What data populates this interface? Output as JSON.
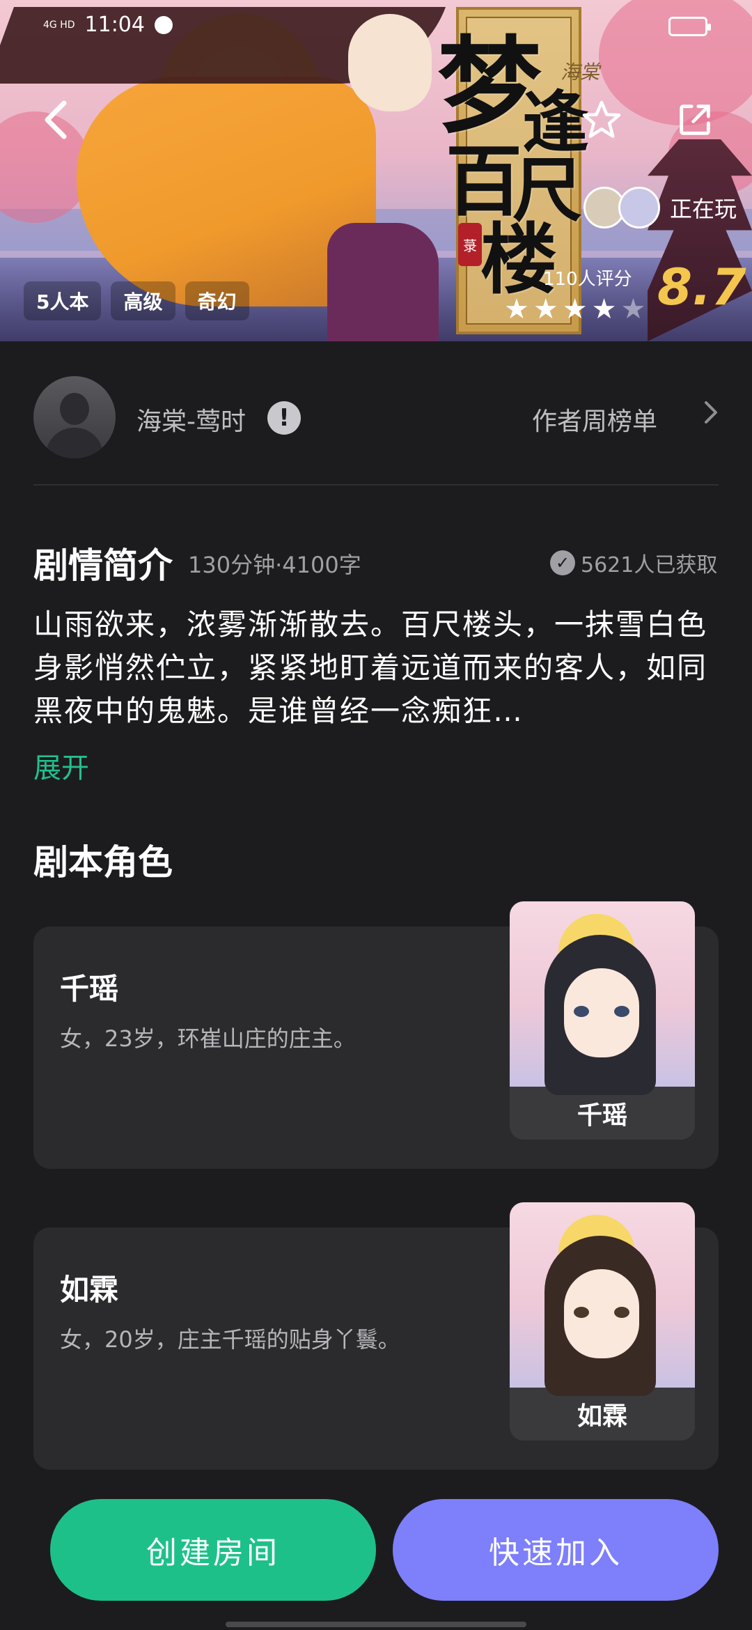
{
  "status_bar": {
    "network": "4G HD",
    "time": "11:04"
  },
  "hero": {
    "title_chars": [
      "梦",
      "逢",
      "百",
      "尺",
      "楼"
    ],
    "subtitle": "海棠",
    "seal": "菉",
    "players_text": "正在玩",
    "reviews_text": "110人评分",
    "rating_stars": 4,
    "rating_total": 5,
    "score": "8.7",
    "tags": [
      "5人本",
      "高级",
      "奇幻"
    ]
  },
  "author": {
    "name": "海棠-莺时",
    "warn_icon_text": "!",
    "rank_label": "作者周榜单"
  },
  "synopsis": {
    "title": "剧情简介",
    "meta": "130分钟·4100字",
    "obtained": "5621人已获取",
    "text": "山雨欲来，浓雾渐渐散去。百尺楼头，一抹雪白色身影悄然伫立，紧紧地盯着远道而来的客人，如同黑夜中的鬼魅。是谁曾经一念痴狂…",
    "expand_label": "展开"
  },
  "roles": {
    "title": "剧本角色",
    "items": [
      {
        "name": "千瑶",
        "desc": "女，23岁，环崔山庄的庄主。",
        "portrait_label": "千瑶"
      },
      {
        "name": "如霖",
        "desc": "女，20岁，庄主千瑶的贴身丫鬟。",
        "portrait_label": "如霖"
      }
    ]
  },
  "actions": {
    "create": "创建房间",
    "join": "快速加入"
  },
  "colors": {
    "accent_green": "#1ec08a",
    "accent_purple": "#7e7ffb",
    "score_gold": "#f4c64e",
    "background": "#1c1c1e"
  },
  "icons": {
    "back": "back-arrow-icon",
    "star": "star-outline-icon",
    "share": "share-icon",
    "check": "check-circle-icon",
    "chevron": "chevron-right-icon"
  }
}
